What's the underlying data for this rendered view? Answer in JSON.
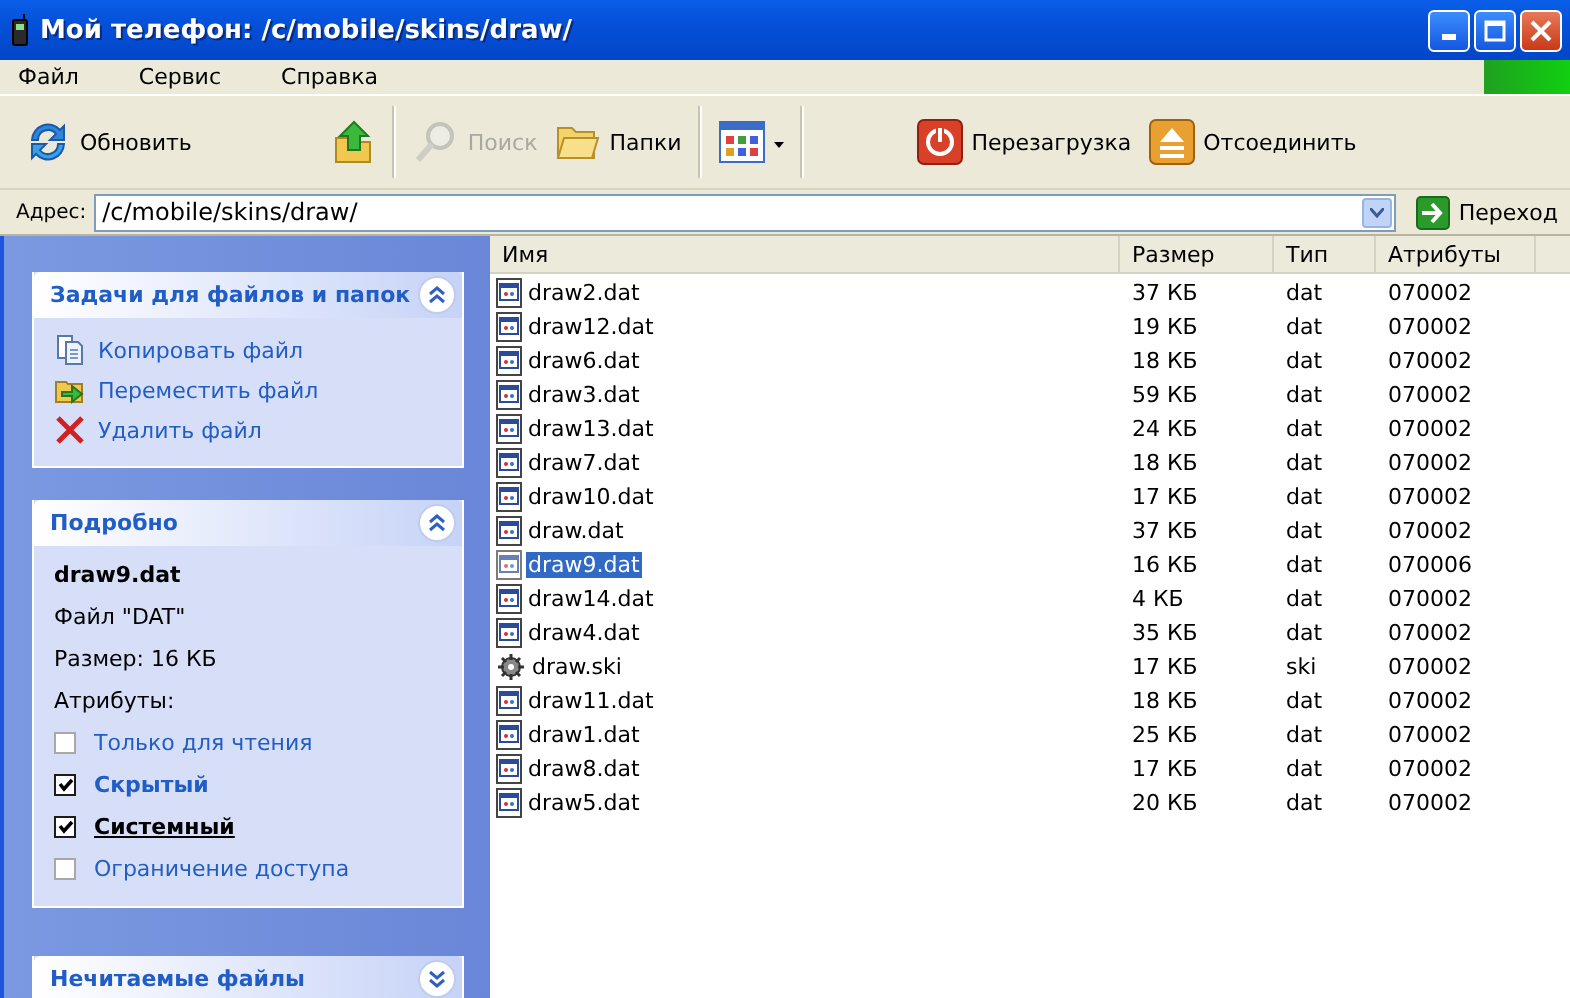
{
  "window": {
    "title": "Мой телефон: /c/mobile/skins/draw/"
  },
  "menu": [
    "Файл",
    "Сервис",
    "Справка"
  ],
  "toolbar": [
    {
      "kind": "refresh",
      "label": "Обновить",
      "disabled": false
    },
    {
      "kind": "up",
      "disabled": false
    },
    {
      "kind": "search",
      "label": "Поиск",
      "disabled": true
    },
    {
      "kind": "folders",
      "label": "Папки",
      "disabled": false
    },
    {
      "kind": "views",
      "disabled": false
    },
    {
      "kind": "reboot",
      "label": "Перезагрузка",
      "disabled": false
    },
    {
      "kind": "eject",
      "label": "Отсоединить",
      "disabled": false
    }
  ],
  "address": {
    "label": "Адрес:",
    "value": "/c/mobile/skins/draw/",
    "go": "Переход"
  },
  "panels": [
    {
      "kind": "tasks",
      "title": "Задачи для файлов и папок",
      "expanded": true,
      "items": [
        {
          "kind": "copy",
          "label": "Копировать файл"
        },
        {
          "kind": "move",
          "label": "Переместить файл"
        },
        {
          "kind": "delete",
          "label": "Удалить файл"
        }
      ]
    },
    {
      "kind": "details",
      "title": "Подробно",
      "expanded": true,
      "name": "draw9.dat",
      "type": "Файл \"DAT\"",
      "size": "Размер: 16 КБ",
      "attributes_label": "Атрибуты:",
      "attributes": [
        {
          "label": "Только для чтения",
          "checked": false,
          "hovered": false
        },
        {
          "label": "Скрытый",
          "checked": true,
          "hovered": false
        },
        {
          "label": "Системный",
          "checked": true,
          "hovered": true
        },
        {
          "label": "Ограничение доступа",
          "checked": false,
          "hovered": false
        }
      ]
    },
    {
      "kind": "plain",
      "title": "Нечитаемые файлы",
      "expanded": false
    }
  ],
  "file_list": {
    "columns": [
      "Имя",
      "Размер",
      "Тип",
      "Атрибуты"
    ],
    "rows": [
      {
        "kind": "dat",
        "name": "draw2.dat",
        "size": "37 КБ",
        "type": "dat",
        "attributes": "070002",
        "selected": false
      },
      {
        "kind": "dat",
        "name": "draw12.dat",
        "size": "19 КБ",
        "type": "dat",
        "attributes": "070002",
        "selected": false
      },
      {
        "kind": "dat",
        "name": "draw6.dat",
        "size": "18 КБ",
        "type": "dat",
        "attributes": "070002",
        "selected": false
      },
      {
        "kind": "dat",
        "name": "draw3.dat",
        "size": "59 КБ",
        "type": "dat",
        "attributes": "070002",
        "selected": false
      },
      {
        "kind": "dat",
        "name": "draw13.dat",
        "size": "24 КБ",
        "type": "dat",
        "attributes": "070002",
        "selected": false
      },
      {
        "kind": "dat",
        "name": "draw7.dat",
        "size": "18 КБ",
        "type": "dat",
        "attributes": "070002",
        "selected": false
      },
      {
        "kind": "dat",
        "name": "draw10.dat",
        "size": "17 КБ",
        "type": "dat",
        "attributes": "070002",
        "selected": false
      },
      {
        "kind": "dat",
        "name": "draw.dat",
        "size": "37 КБ",
        "type": "dat",
        "attributes": "070002",
        "selected": false
      },
      {
        "kind": "dat",
        "name": "draw9.dat",
        "size": "16 КБ",
        "type": "dat",
        "attributes": "070006",
        "selected": true
      },
      {
        "kind": "dat",
        "name": "draw14.dat",
        "size": "4 КБ",
        "type": "dat",
        "attributes": "070002",
        "selected": false
      },
      {
        "kind": "dat",
        "name": "draw4.dat",
        "size": "35 КБ",
        "type": "dat",
        "attributes": "070002",
        "selected": false
      },
      {
        "kind": "ski",
        "name": "draw.ski",
        "size": "17 КБ",
        "type": "ski",
        "attributes": "070002",
        "selected": false
      },
      {
        "kind": "dat",
        "name": "draw11.dat",
        "size": "18 КБ",
        "type": "dat",
        "attributes": "070002",
        "selected": false
      },
      {
        "kind": "dat",
        "name": "draw1.dat",
        "size": "25 КБ",
        "type": "dat",
        "attributes": "070002",
        "selected": false
      },
      {
        "kind": "dat",
        "name": "draw8.dat",
        "size": "17 КБ",
        "type": "dat",
        "attributes": "070002",
        "selected": false
      },
      {
        "kind": "dat",
        "name": "draw5.dat",
        "size": "20 КБ",
        "type": "dat",
        "attributes": "070002",
        "selected": false
      }
    ]
  }
}
